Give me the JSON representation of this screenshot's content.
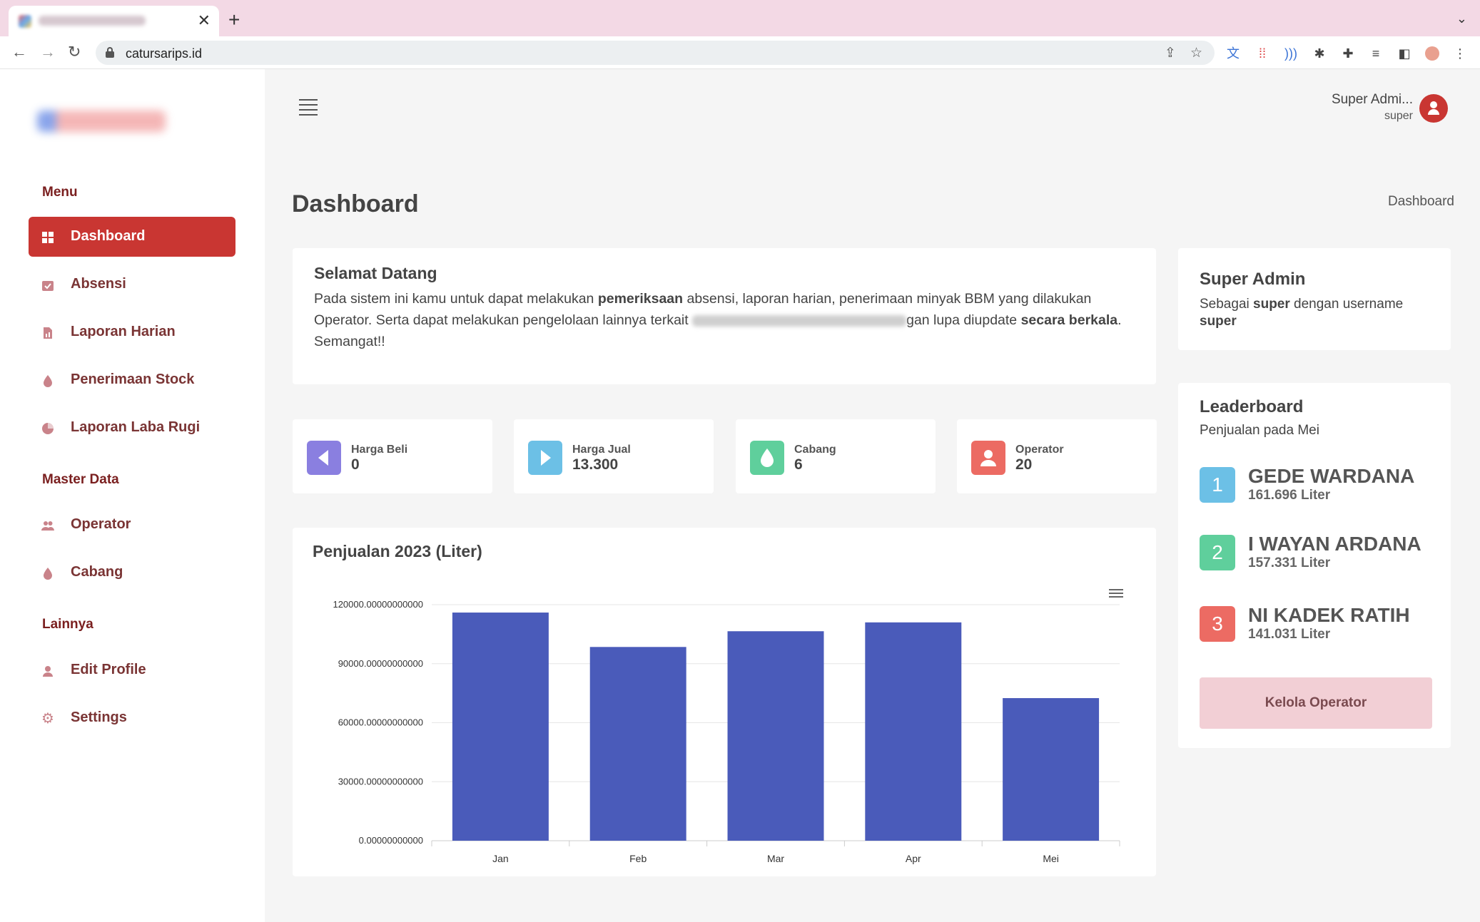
{
  "browser": {
    "url": "catursarips.id",
    "tab_close": "✕",
    "new_tab": "+",
    "chevron": "⌄"
  },
  "sidebar": {
    "sections": [
      {
        "title": "Menu"
      },
      {
        "title": "Master Data"
      },
      {
        "title": "Lainnya"
      }
    ],
    "items": [
      {
        "label": "Dashboard",
        "icon": "grid-icon",
        "active": true
      },
      {
        "label": "Absensi",
        "icon": "calendar-check-icon"
      },
      {
        "label": "Laporan Harian",
        "icon": "report-icon"
      },
      {
        "label": "Penerimaan Stock",
        "icon": "droplet-icon"
      },
      {
        "label": "Laporan Laba Rugi",
        "icon": "pie-chart-icon"
      },
      {
        "label": "Operator",
        "icon": "users-icon"
      },
      {
        "label": "Cabang",
        "icon": "droplet-icon"
      },
      {
        "label": "Edit Profile",
        "icon": "user-icon"
      },
      {
        "label": "Settings",
        "icon": "gear-icon"
      }
    ]
  },
  "header": {
    "user_name": "Super Admi...",
    "user_role": "super"
  },
  "page": {
    "title": "Dashboard",
    "breadcrumb": "Dashboard"
  },
  "welcome": {
    "title": "Selamat Datang",
    "t1": "Pada sistem ini kamu untuk dapat melakukan ",
    "b1": "pemeriksaan",
    "t2": " absensi, laporan harian, penerimaan minyak BBM yang dilakukan Operator. Serta dapat melakukan pengelolaan lainnya terkait ",
    "t3": "gan lupa diupdate ",
    "b2": "secara berkala",
    "t4": ". Semangat!!"
  },
  "stats": [
    {
      "label": "Harga Beli",
      "value": "0",
      "color": "#8a7fe0",
      "icon": "chevron-left-icon"
    },
    {
      "label": "Harga Jual",
      "value": "13.300",
      "color": "#6cc0e6",
      "icon": "chevron-right-icon"
    },
    {
      "label": "Cabang",
      "value": "6",
      "color": "#5fcf9c",
      "icon": "droplet-icon"
    },
    {
      "label": "Operator",
      "value": "20",
      "color": "#ec6b63",
      "icon": "user-icon"
    }
  ],
  "chart_data": {
    "type": "bar",
    "title": "Penjualan 2023 (Liter)",
    "categories": [
      "Jan",
      "Feb",
      "Mar",
      "Apr",
      "Mei"
    ],
    "values": [
      116000,
      98500,
      106500,
      111000,
      72500
    ],
    "ylim": [
      0,
      120000
    ],
    "yticks": [
      "0.00000000000",
      "30000.00000000000",
      "60000.00000000000",
      "90000.00000000000",
      "120000.00000000000"
    ],
    "color": "#4a5bba",
    "grid": true,
    "xlabel": "",
    "ylabel": ""
  },
  "admin_card": {
    "title": "Super Admin",
    "d1": "Sebagai ",
    "b1": "super",
    "d2": " dengan username ",
    "b2": "super"
  },
  "leaderboard": {
    "title": "Leaderboard",
    "subtitle": "Penjualan pada Mei",
    "entries": [
      {
        "rank": "1",
        "name": "GEDE WARDANA",
        "amount": "161.696 Liter",
        "color": "#6cc0e6"
      },
      {
        "rank": "2",
        "name": "I WAYAN ARDANA",
        "amount": "157.331 Liter",
        "color": "#5fcf9c"
      },
      {
        "rank": "3",
        "name": "NI KADEK RATIH",
        "amount": "141.031 Liter",
        "color": "#ec6b63"
      }
    ],
    "button": "Kelola Operator"
  }
}
